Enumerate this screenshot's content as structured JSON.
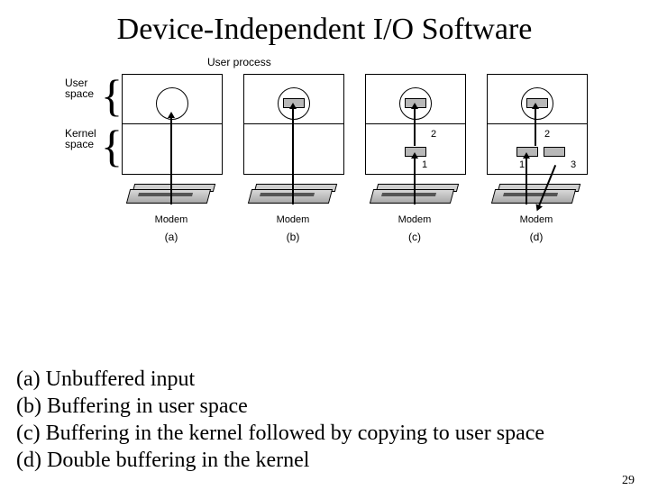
{
  "title": "Device-Independent I/O Software",
  "labels": {
    "user_process": "User process",
    "user_space": "User\nspace",
    "kernel_space": "Kernel\nspace",
    "modem": "Modem"
  },
  "panels": {
    "a": "(a)",
    "b": "(b)",
    "c": "(c)",
    "d": "(d)"
  },
  "arrow_numbers": {
    "one": "1",
    "two": "2",
    "three": "3"
  },
  "captions": {
    "a": "(a) Unbuffered input",
    "b": "(b) Buffering in user space",
    "c": "(c) Buffering in the kernel followed by copying to user space",
    "d": "(d) Double buffering in the kernel"
  },
  "page": "29"
}
